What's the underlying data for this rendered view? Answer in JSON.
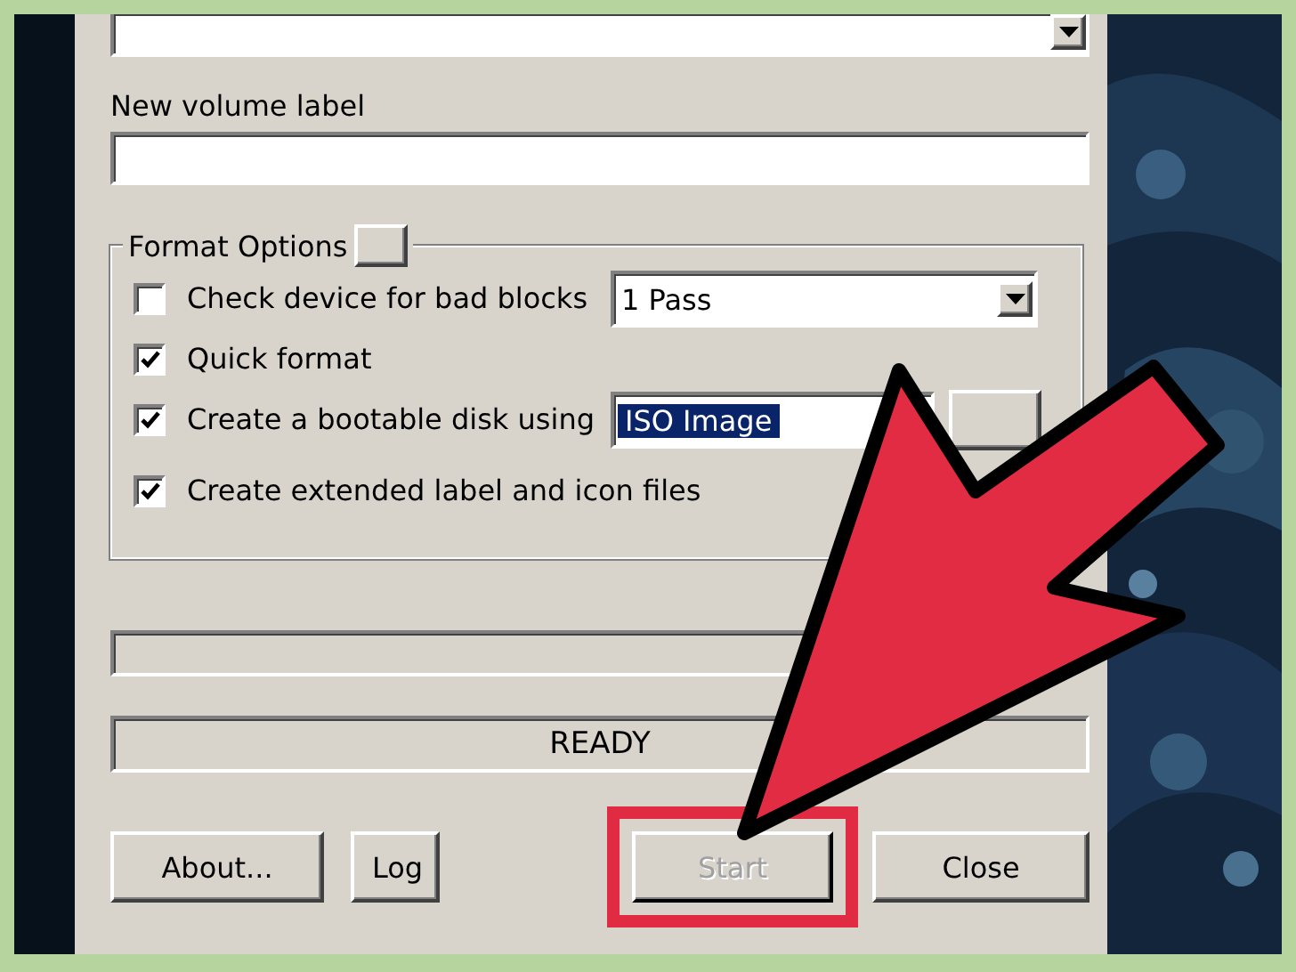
{
  "device_dropdown": {
    "expanded": false
  },
  "volume_label": {
    "label": "New volume label"
  },
  "format_options": {
    "title": "Format Options",
    "expanded": false,
    "rows": [
      {
        "kind": "checkbox_dropdown",
        "label": "Check device for bad blocks",
        "checked": false,
        "dropdown": {
          "value": "1 Pass",
          "focused": false
        }
      },
      {
        "kind": "checkbox",
        "label": "Quick format",
        "checked": true
      },
      {
        "kind": "checkbox_dropdown_button",
        "label": "Create a bootable disk using",
        "checked": true,
        "dropdown": {
          "value": "ISO Image",
          "focused": true
        }
      },
      {
        "kind": "checkbox",
        "label": "Create extended label and icon files",
        "checked": true
      }
    ]
  },
  "progress": {
    "level": 0
  },
  "status": "READY",
  "buttons": [
    {
      "label": "About...",
      "disabled": false,
      "highlighted": false
    },
    {
      "label": "Log",
      "disabled": false,
      "highlighted": false
    },
    {
      "label": "Start",
      "disabled": true,
      "highlighted": true
    },
    {
      "label": "Close",
      "disabled": false,
      "highlighted": false
    }
  ]
}
